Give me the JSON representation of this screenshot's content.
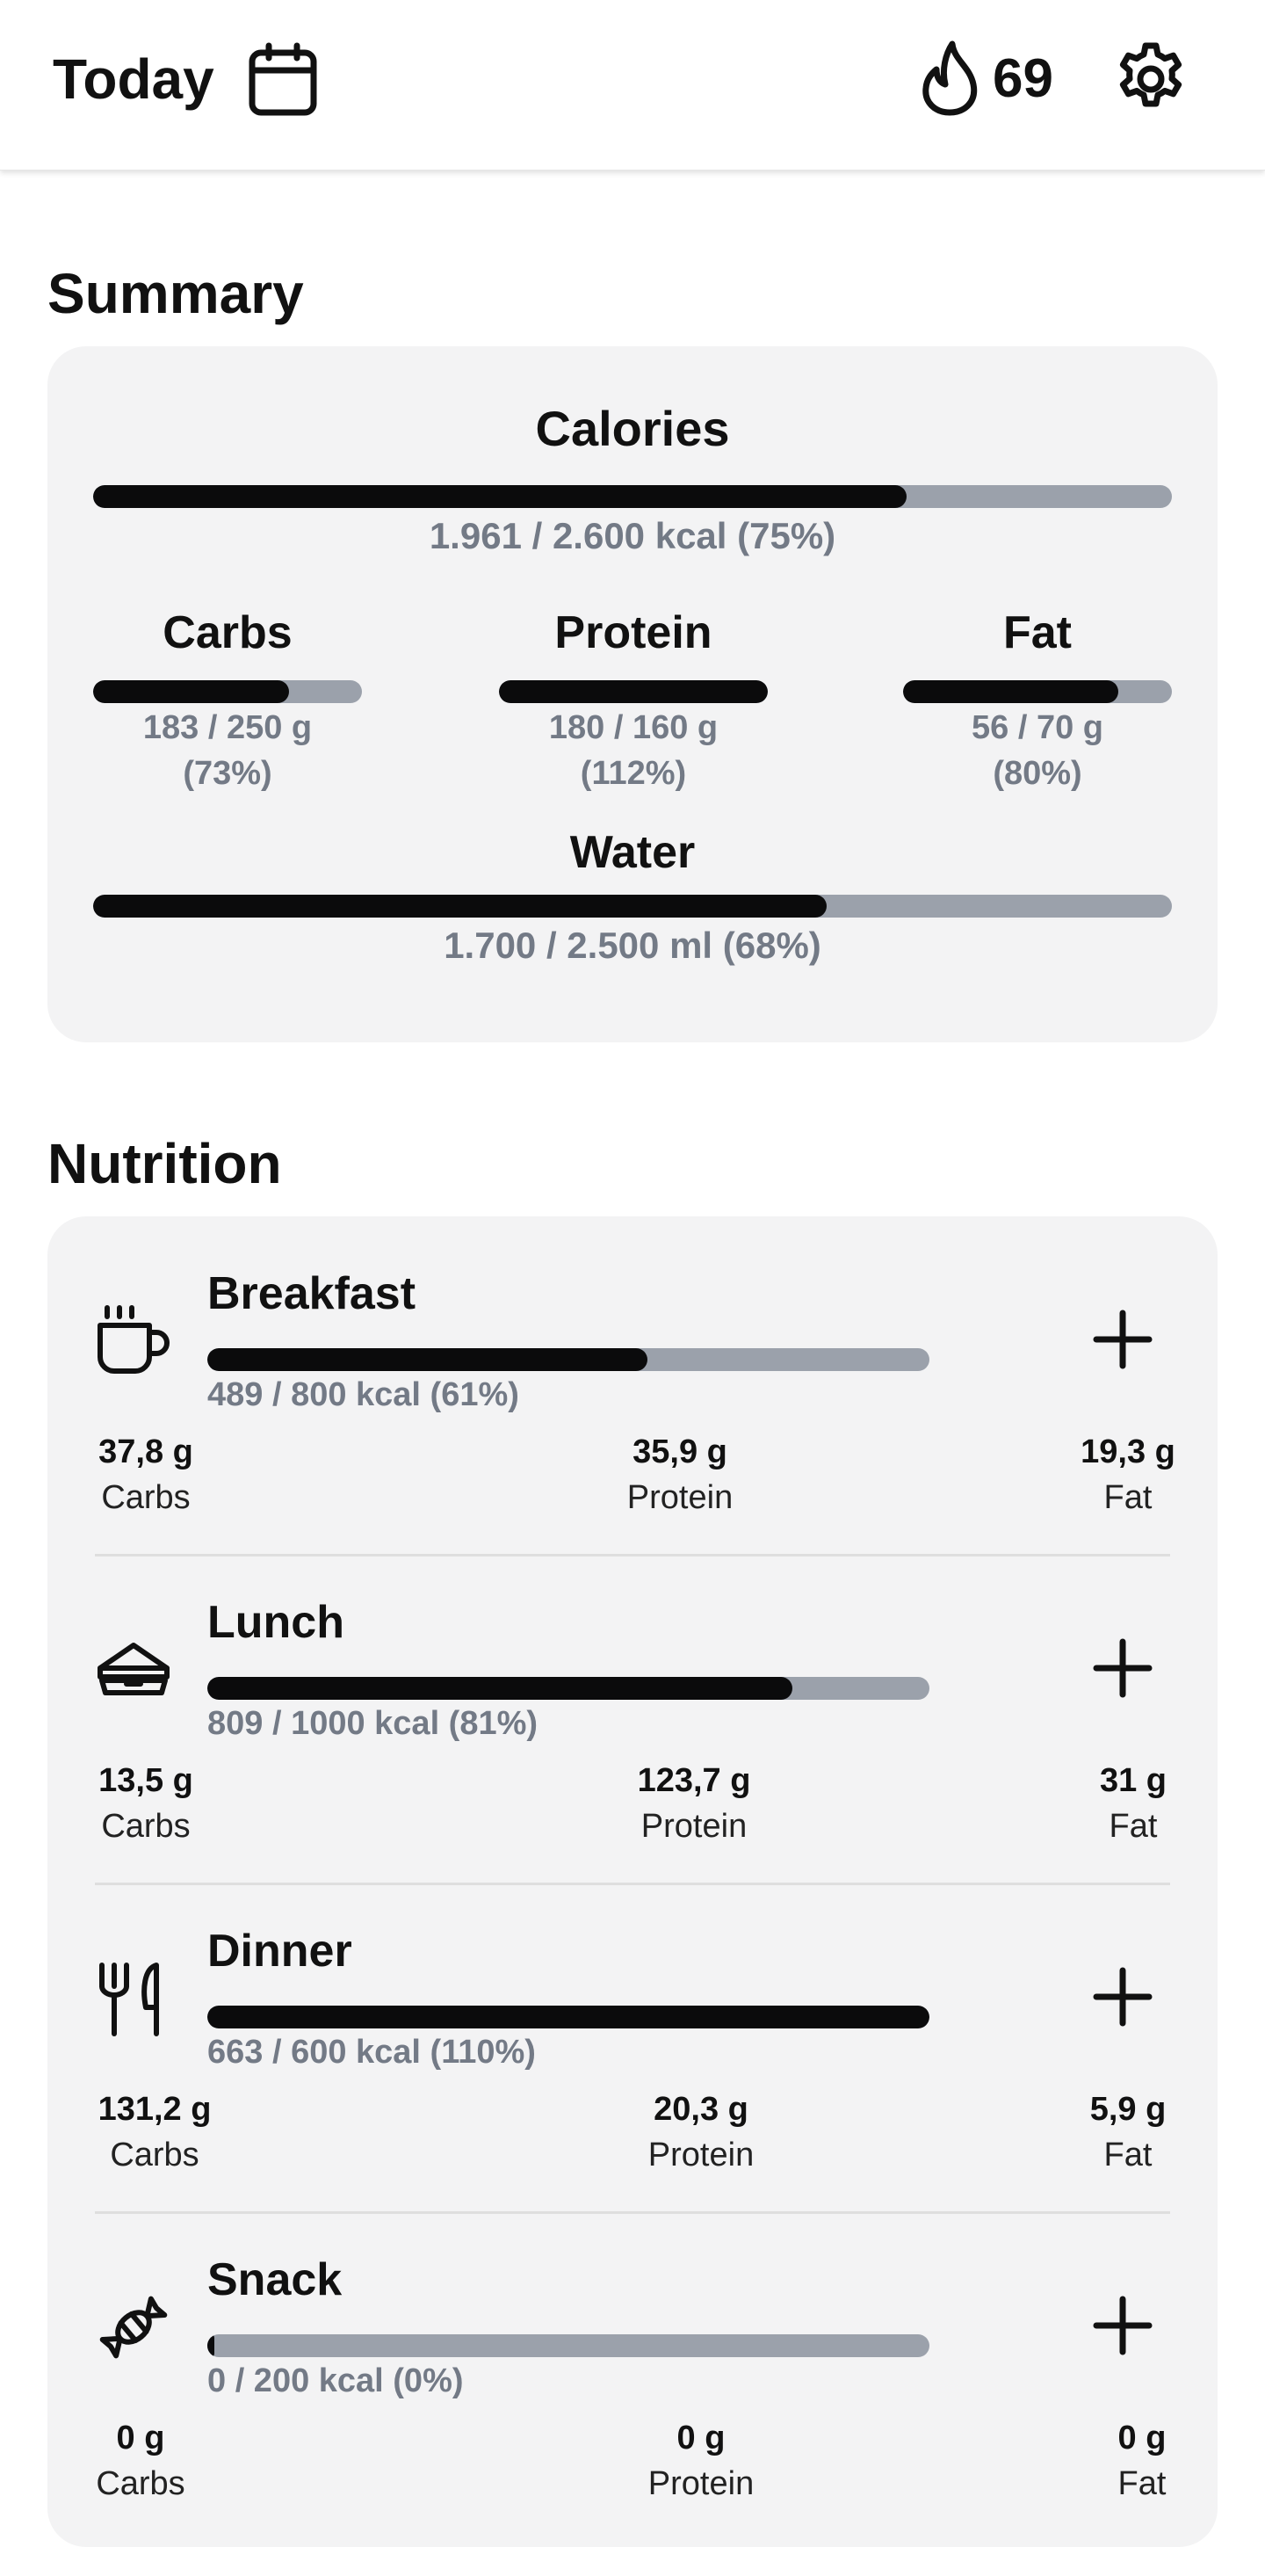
{
  "header": {
    "title": "Today",
    "streak": "69",
    "icons": {
      "calendar": "calendar-icon",
      "flame": "flame-icon",
      "settings": "gear-icon"
    }
  },
  "summary": {
    "section_title": "Summary",
    "calories": {
      "label": "Calories",
      "text": "1.961 / 2.600 kcal (75%)",
      "progress": 0.754
    },
    "carbs": {
      "label": "Carbs",
      "line1": "183 / 250 g",
      "line2": "(73%)",
      "progress": 0.73
    },
    "protein": {
      "label": "Protein",
      "line1": "180 / 160 g",
      "line2": "(112%)",
      "progress": 1.0
    },
    "fat": {
      "label": "Fat",
      "line1": "56 / 70 g",
      "line2": "(80%)",
      "progress": 0.8
    },
    "water": {
      "label": "Water",
      "text": "1.700 / 2.500 ml (68%)",
      "progress": 0.68
    }
  },
  "nutrition": {
    "section_title": "Nutrition",
    "meals": [
      {
        "name": "Breakfast",
        "icon": "coffee-cup-icon",
        "kcal": "489 / 800 kcal (61%)",
        "progress": 0.61,
        "carbs": "37,8 g",
        "protein": "35,9 g",
        "fat": "19,3 g",
        "carbs_label": "Carbs",
        "protein_label": "Protein",
        "fat_label": "Fat"
      },
      {
        "name": "Lunch",
        "icon": "sandwich-icon",
        "kcal": "809 / 1000 kcal (81%)",
        "progress": 0.81,
        "carbs": "13,5 g",
        "protein": "123,7 g",
        "fat": "31 g",
        "carbs_label": "Carbs",
        "protein_label": "Protein",
        "fat_label": "Fat"
      },
      {
        "name": "Dinner",
        "icon": "cutlery-icon",
        "kcal": "663 / 600 kcal (110%)",
        "progress": 1.0,
        "carbs": "131,2 g",
        "protein": "20,3 g",
        "fat": "5,9 g",
        "carbs_label": "Carbs",
        "protein_label": "Protein",
        "fat_label": "Fat"
      },
      {
        "name": "Snack",
        "icon": "candy-icon",
        "kcal": "0 / 200 kcal (0%)",
        "progress": 0.0,
        "carbs": "0 g",
        "protein": "0 g",
        "fat": "0 g",
        "carbs_label": "Carbs",
        "protein_label": "Protein",
        "fat_label": "Fat"
      }
    ]
  },
  "colors": {
    "bar_fill": "#0b0b0c",
    "bar_track": "#9ba1ab",
    "card_bg": "#f3f3f4",
    "muted_text": "#737a86"
  }
}
